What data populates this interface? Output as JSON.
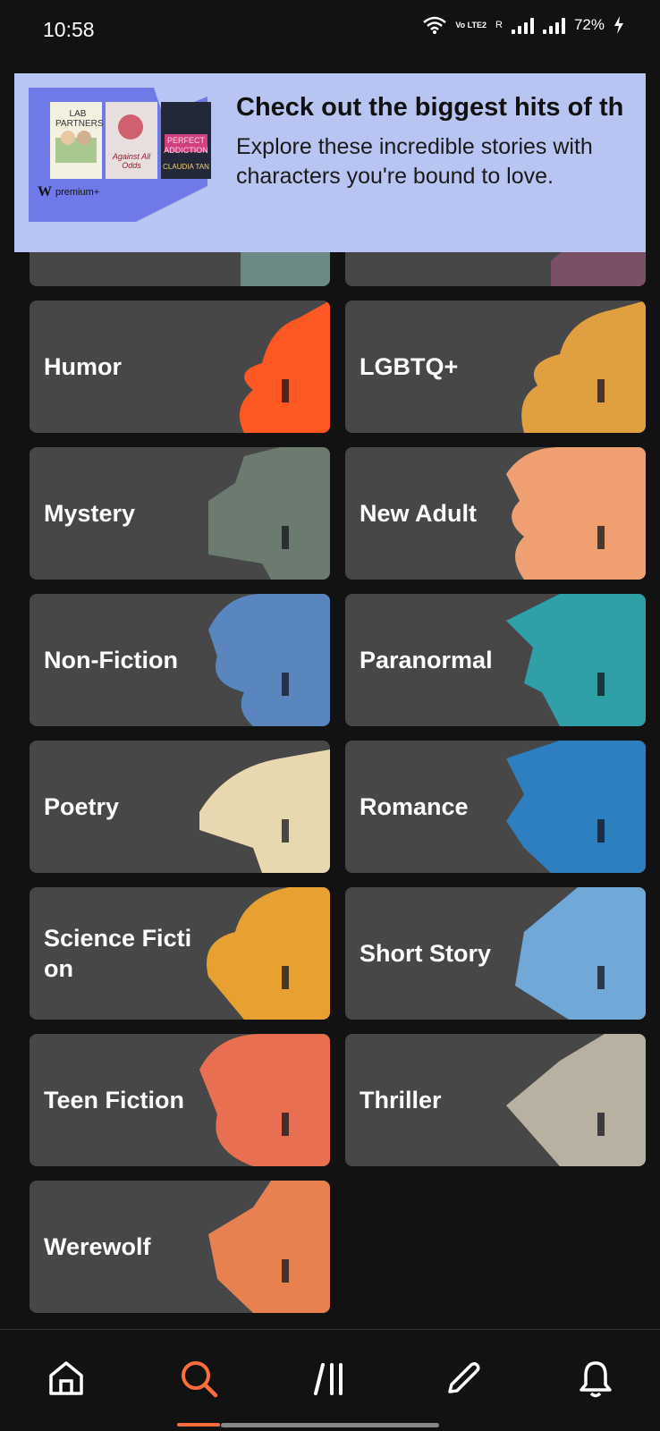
{
  "status_bar": {
    "time": "10:58",
    "battery": "72%",
    "network_label": "Vo LTE2",
    "roaming": "R"
  },
  "banner": {
    "title": "Check out the biggest hits of th",
    "subtitle": "Explore these incredible stories with characters you're bound to love.",
    "art": {
      "book1": "LAB PARTNERS",
      "book2": "Against All Odds",
      "book3": "PERFECT ADDICTION",
      "book3_author": "CLAUDIA TAN",
      "brand": "premium+"
    }
  },
  "categories": [
    {
      "label": "Humor",
      "color": "#ff5722"
    },
    {
      "label": "LGBTQ+",
      "color": "#e0a040"
    },
    {
      "label": "Mystery",
      "color": "#6b7b70"
    },
    {
      "label": "New Adult",
      "color": "#f0a070"
    },
    {
      "label": "Non-Fiction",
      "color": "#5a86c0"
    },
    {
      "label": "Paranormal",
      "color": "#2fa0a8"
    },
    {
      "label": "Poetry",
      "color": "#e8d8b0"
    },
    {
      "label": "Romance",
      "color": "#2d7fc2"
    },
    {
      "label": "Science Fiction",
      "color": "#e8a030"
    },
    {
      "label": "Short Story",
      "color": "#70a8d8"
    },
    {
      "label": "Teen Fiction",
      "color": "#e87050"
    },
    {
      "label": "Thriller",
      "color": "#b8b0a0"
    },
    {
      "label": "Werewolf",
      "color": "#e88050"
    }
  ],
  "bottom_nav": {
    "items": [
      "home-icon",
      "search-icon",
      "library-icon",
      "write-icon",
      "notifications-icon"
    ],
    "active": "search-icon",
    "accent": "#ff6d3d"
  }
}
